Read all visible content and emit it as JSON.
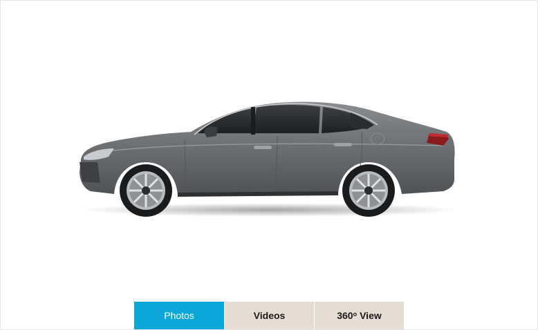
{
  "gallery": {
    "image_alt": "Grey sedan side profile",
    "tabs": [
      {
        "label": "Photos",
        "active": true
      },
      {
        "label": "Videos",
        "active": false
      },
      {
        "label_main": "360",
        "label_sup": "o",
        "label_rest": "View",
        "active": false
      }
    ]
  },
  "colors": {
    "active_tab": "#0ba7d8",
    "inactive_tab": "#e5ddd4",
    "car_body": "#6c6f72"
  }
}
